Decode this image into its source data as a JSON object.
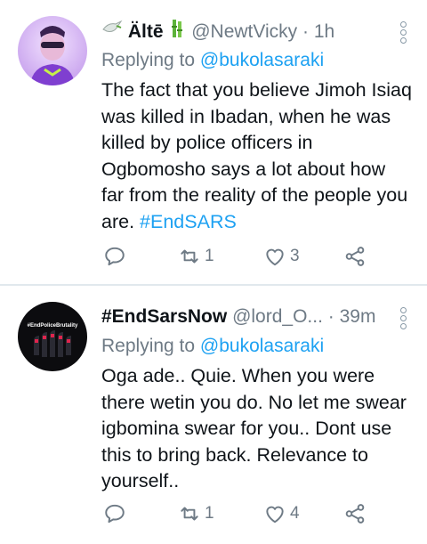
{
  "tweets": [
    {
      "name_prefix_emoji": "peace-dove",
      "name": "Ältē",
      "name_suffix_emoji": "bamboo",
      "handle": "@NewtVicky",
      "dot": "·",
      "time": "1h",
      "replying_label": "Replying to",
      "replying_to": "@bukolasaraki",
      "text": "The fact that you believe Jimoh Isiaq was killed in Ibadan, when he was killed by police officers in Ogbomosho says a lot about how far from the reality of the people you are.",
      "hashtag": "#EndSARS",
      "reply_count": "",
      "retweet_count": "1",
      "like_count": "3"
    },
    {
      "name": "#EndSarsNow",
      "handle": "@lord_O...",
      "dot": "·",
      "time": "39m",
      "replying_label": "Replying to",
      "replying_to": "@bukolasaraki",
      "text": "Oga ade.. Quie. When you were there wetin you do. No let me swear igbomina swear for you.. Dont use this to bring back. Relevance to yourself..",
      "avatar_caption": "#EndPoliceBrutality",
      "reply_count": "",
      "retweet_count": "1",
      "like_count": "4"
    }
  ],
  "colors": {
    "accent": "#1da1f2",
    "secondary_text": "#6e7a85",
    "primary_text": "#0f1419",
    "divider": "#e1e8ed"
  }
}
